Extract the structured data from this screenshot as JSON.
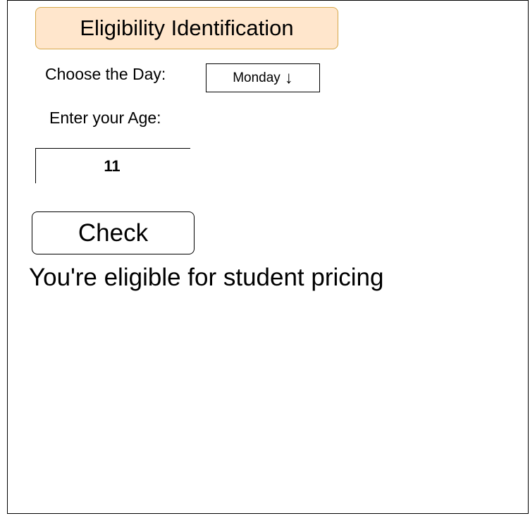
{
  "header": {
    "title": "Eligibility Identification",
    "title_bg_color": "#ffe6cc",
    "title_border_color": "#d6a84a"
  },
  "form": {
    "day_label": "Choose the Day:",
    "day_value": "Monday",
    "day_dropdown_icon": "down-arrow-icon",
    "age_label": "Enter your Age:",
    "age_value": "11",
    "check_button_label": "Check"
  },
  "result": {
    "message": "You're eligible for student pricing"
  }
}
